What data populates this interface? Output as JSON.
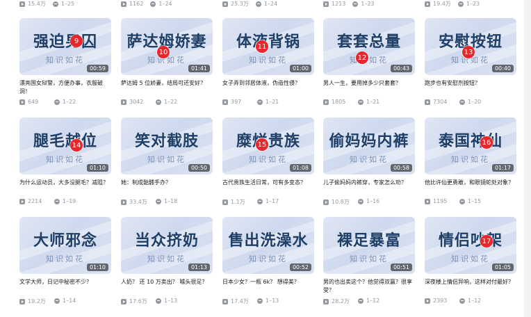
{
  "top_row": [
    {
      "plays": "15.4万",
      "episodes": "1–25"
    },
    {
      "plays": "1162",
      "episodes": "1–24"
    },
    {
      "plays": "25.3万",
      "episodes": "1–24"
    },
    {
      "plays": "1213",
      "episodes": "1–23"
    },
    {
      "plays": "19.4万",
      "episodes": "1–23"
    }
  ],
  "brand": "知识如花",
  "cards": [
    {
      "title": "强迫男囚",
      "badge": "9",
      "duration": "00:59",
      "desc": "漂亮国女狱警，方便办事，衣服破洞！",
      "plays": "649",
      "episodes": "1–22"
    },
    {
      "title": "萨达姆娇妻",
      "badge": "10",
      "duration": "01:41",
      "desc": "萨达姆 5 位娇妻，结局可还安好？",
      "plays": "3042",
      "episodes": "1–22"
    },
    {
      "title": "体液背锅",
      "badge": "11",
      "duration": "01:00",
      "desc": "女子弄到邻居体液，伪造性侵？",
      "plays": "397",
      "episodes": "1–21"
    },
    {
      "title": "套套总量",
      "badge": "12",
      "duration": "00:43",
      "desc": "男人一生，要用掉多少只套套？",
      "plays": "1805",
      "episodes": "1–21"
    },
    {
      "title": "安慰按钮",
      "badge": "13",
      "duration": "00:40",
      "desc": "跑步也有安慰剂按钮？",
      "plays": "7304",
      "episodes": "1–20"
    },
    {
      "title": "腿毛越位",
      "badge": "14",
      "duration": "01:10",
      "desc": "为什么运动员，大多没腿毛？减阻？",
      "plays": "2214",
      "episodes": "1–19"
    },
    {
      "title": "笑对截肢",
      "badge": "",
      "duration": "00:50",
      "desc": "她：制成骷髅手办？",
      "plays": "33.4万",
      "episodes": "1–18"
    },
    {
      "title": "糜烂贵族",
      "badge": "15",
      "duration": "01:08",
      "desc": "古代贵族生活日常，可有多变态？",
      "plays": "1.1万",
      "episodes": "1–17"
    },
    {
      "title": "偷妈妈内裤",
      "badge": "",
      "duration": "00:58",
      "desc": "儿子偷妈妈内裤穿，专家怎么劝？",
      "plays": "10.8万",
      "episodes": "1–16"
    },
    {
      "title": "泰国神仙",
      "badge": "16",
      "duration": "01:17",
      "desc": "他比许仙更勇敢，和眼镜蛇处对象？",
      "plays": "1195",
      "episodes": "1–15"
    },
    {
      "title": "大师邪念",
      "badge": "",
      "duration": "01:10",
      "desc": "文学大师，日记中秘密不少？",
      "plays": "19.2万",
      "episodes": "1–14"
    },
    {
      "title": "当众挤奶",
      "badge": "",
      "duration": "01:13",
      "desc": "人奶？ 还 10 万卖出？ 噱头很足？",
      "plays": "17.6万",
      "episodes": "1–13"
    },
    {
      "title": "售出洗澡水",
      "badge": "",
      "duration": "00:52",
      "desc": "日本少女？一瓶 6k？ 想得美？",
      "plays": "17.4万",
      "episodes": "1–13"
    },
    {
      "title": "裸足暴富",
      "badge": "",
      "duration": "00:51",
      "desc": "男的也出卖这个？他觉得双赢？很享受？",
      "plays": "28.2万",
      "episodes": "1–12"
    },
    {
      "title": "情侣吵架",
      "badge": "17",
      "duration": "01:05",
      "desc": "深夜楼上情侣异响，这样对付最好？",
      "plays": "2393",
      "episodes": "1–12"
    }
  ],
  "colors": {
    "badge": "#e8272c",
    "thumb_title": "#1f3f66",
    "meta": "#9499a0"
  }
}
